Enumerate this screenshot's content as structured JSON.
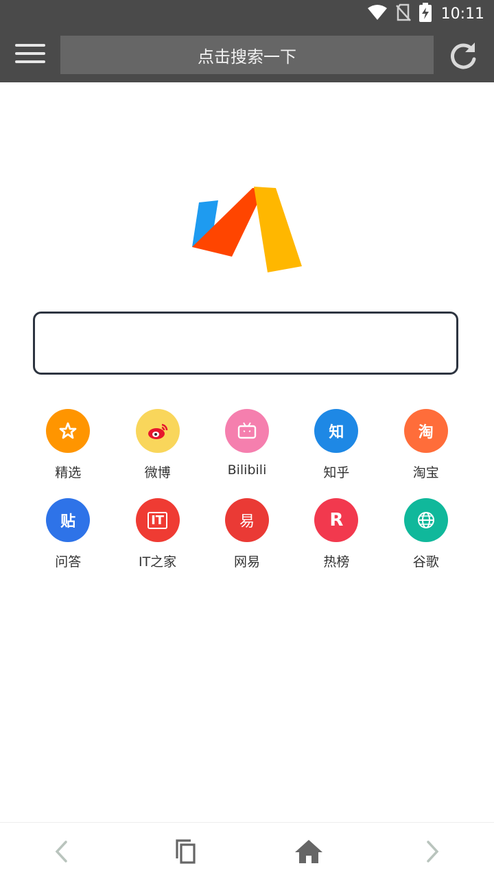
{
  "status_bar": {
    "time": "10:11",
    "icons": [
      "wifi-icon",
      "no-sim-icon",
      "battery-charging-icon"
    ]
  },
  "toolbar": {
    "search_label": "点击搜索一下",
    "menu_icon": "menu-icon",
    "refresh_icon": "refresh-icon",
    "background": "#4a4a4a"
  },
  "logo": {
    "colors": [
      "#1E9BF0",
      "#FF4500",
      "#FFB700"
    ]
  },
  "main_search": {
    "value": "",
    "placeholder": ""
  },
  "shortcuts": [
    {
      "label": "精选",
      "icon": "star-icon",
      "glyph": "☆",
      "color": "#FF9500"
    },
    {
      "label": "微博",
      "icon": "weibo-icon",
      "glyph": "",
      "color": "#F9D65B"
    },
    {
      "label": "Bilibili",
      "icon": "bilibili-tv-icon",
      "glyph": "",
      "color": "#F57FAE"
    },
    {
      "label": "知乎",
      "icon": "zhihu-icon",
      "glyph": "知",
      "color": "#1E88E5"
    },
    {
      "label": "淘宝",
      "icon": "taobao-icon",
      "glyph": "淘",
      "color": "#FF6D3A"
    },
    {
      "label": "问答",
      "icon": "tieba-icon",
      "glyph": "贴",
      "color": "#2E73E8"
    },
    {
      "label": "IT之家",
      "icon": "ithome-icon",
      "glyph": "IT",
      "color": "#EF3B33"
    },
    {
      "label": "网易",
      "icon": "netease-icon",
      "glyph": "易",
      "color": "#EA3A35"
    },
    {
      "label": "热榜",
      "icon": "rebang-icon",
      "glyph": "R",
      "color": "#F2394E"
    },
    {
      "label": "谷歌",
      "icon": "globe-icon",
      "glyph": "",
      "color": "#10B89B"
    }
  ],
  "bottom_nav": {
    "icons": [
      "back-icon",
      "tabs-icon",
      "home-icon",
      "forward-icon"
    ]
  }
}
